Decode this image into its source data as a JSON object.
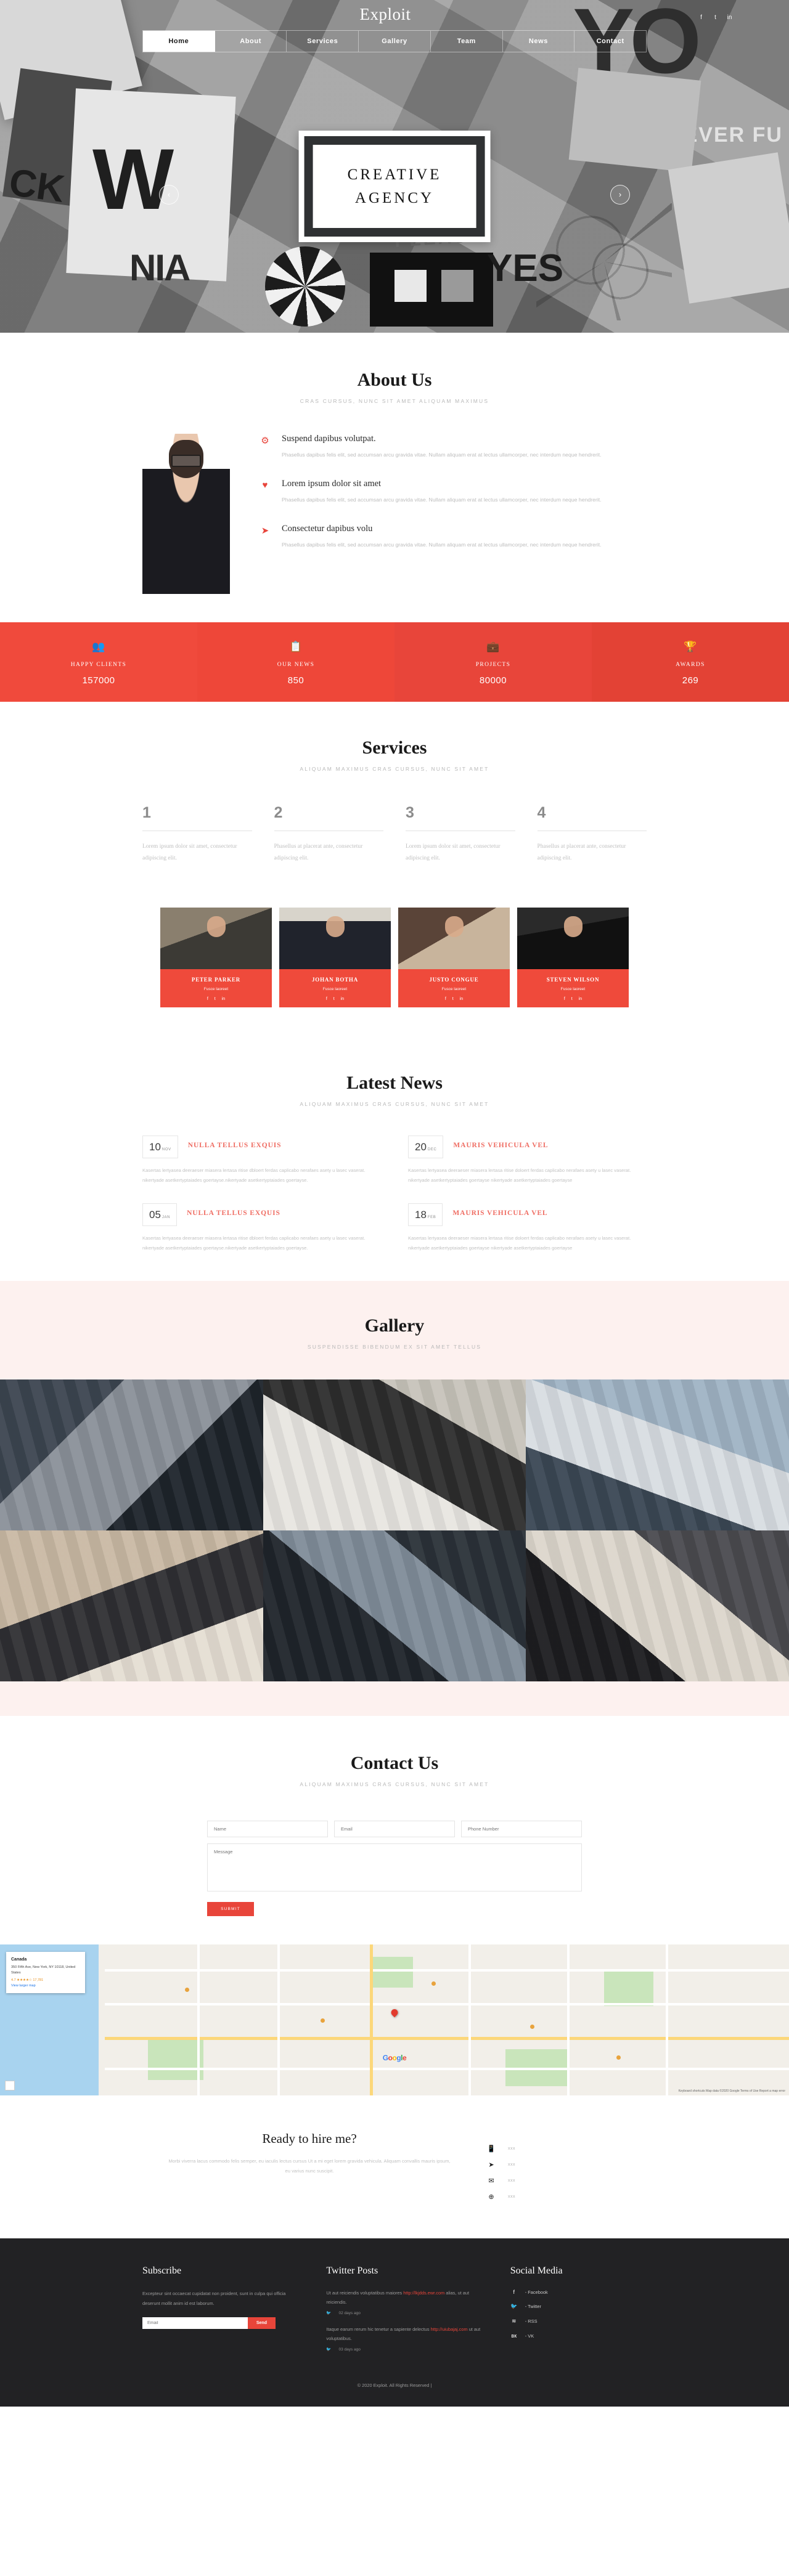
{
  "brand": "Exploit",
  "nav": {
    "items": [
      {
        "label": "Home",
        "active": true
      },
      {
        "label": "About",
        "active": false
      },
      {
        "label": "Services",
        "active": false
      },
      {
        "label": "Gallery",
        "active": false
      },
      {
        "label": "Team",
        "active": false
      },
      {
        "label": "News",
        "active": false
      },
      {
        "label": "Contact",
        "active": false
      }
    ],
    "social": [
      "f",
      "t",
      "in"
    ]
  },
  "hero": {
    "title_line1": "CREATIVE",
    "title_line2": "AGENCY",
    "prev": "‹",
    "next": "›"
  },
  "about": {
    "title": "About Us",
    "subtitle": "CRAS CURSUS, NUNC SIT AMET ALIQUAM MAXIMUS",
    "items": [
      {
        "icon": "gear-icon",
        "glyph": "⚙",
        "heading": "Suspend dapibus volutpat.",
        "text": "Phasellus dapibus felis elit, sed accumsan arcu gravida vitae. Nullam aliquam erat at lectus ullamcorper, nec interdum neque hendrerit."
      },
      {
        "icon": "heart-icon",
        "glyph": "♥",
        "heading": "Lorem ipsum dolor sit amet",
        "text": "Phasellus dapibus felis elit, sed accumsan arcu gravida vitae. Nullam aliquam erat at lectus ullamcorper, nec interdum neque hendrerit."
      },
      {
        "icon": "paper-plane-icon",
        "glyph": "➤",
        "heading": "Consectetur dapibus volu",
        "text": "Phasellus dapibus felis elit, sed accumsan arcu gravida vitae. Nullam aliquam erat at lectus ullamcorper, nec interdum neque hendrerit."
      }
    ]
  },
  "counters": [
    {
      "icon": "users-icon",
      "glyph": "👥",
      "label": "HAPPY CLIENTS",
      "value": "157000"
    },
    {
      "icon": "clipboard-icon",
      "glyph": "📋",
      "label": "OUR NEWS",
      "value": "850"
    },
    {
      "icon": "briefcase-icon",
      "glyph": "💼",
      "label": "PROJECTS",
      "value": "80000"
    },
    {
      "icon": "trophy-icon",
      "glyph": "🏆",
      "label": "AWARDS",
      "value": "269"
    }
  ],
  "services": {
    "title": "Services",
    "subtitle": "ALIQUAM MAXIMUS CRAS CURSUS, NUNC SIT AMET",
    "items": [
      {
        "num": "1",
        "text": "Lorem ipsum dolor sit amet, consectetur adipiscing elit."
      },
      {
        "num": "2",
        "text": "Phasellus at placerat ante, consectetur adipiscing elit."
      },
      {
        "num": "3",
        "text": "Lorem ipsum dolor sit amet, consectetur adipiscing elit."
      },
      {
        "num": "4",
        "text": "Phasellus at placerat ante, consectetur adipiscing elit."
      }
    ]
  },
  "team": {
    "members": [
      {
        "name": "PETER PARKER",
        "role": "Fusce laoreet"
      },
      {
        "name": "JOHAN BOTHA",
        "role": "Fusce laoreet"
      },
      {
        "name": "JUSTO CONGUE",
        "role": "Fusce laoreet"
      },
      {
        "name": "STEVEN WILSON",
        "role": "Fusce laoreet"
      }
    ],
    "social": [
      "f",
      "t",
      "in"
    ]
  },
  "news": {
    "title": "Latest News",
    "subtitle": "ALIQUAM MAXIMUS CRAS CURSUS, NUNC SIT AMET",
    "items": [
      {
        "day": "10",
        "month": "NOV",
        "title": "NULLA TELLUS EXQUIS",
        "text": "Kasertas lertyasea deeraeser miasera lertasa ritise dbloert ferdas caplicabo nerafaes asety u lasec vaserat. nikertyade asetkertyptaiades goertayse.nikertyade asetkertyptaiades goertayse."
      },
      {
        "day": "20",
        "month": "DEC",
        "title": "MAURIS VEHICULA VEL",
        "text": "Kasertas lertyasea deeraeser miasera lertasa ritise doloert ferdas caplicabo nerafaes asety u lasec vaserat. nikertyade asetkertyptaiades goertayse nikertyade asetkertyptaiades goertayse"
      },
      {
        "day": "05",
        "month": "JAN",
        "title": "NULLA TELLUS EXQUIS",
        "text": "Kasertas lertyasea deeraeser miasera lertasa ritise dbloert ferdas caplicabo nerafaes asety u lasec vaserat. nikertyade asetkertyptaiades goertayse.nikertyade asetkertyptaiades goertayse."
      },
      {
        "day": "18",
        "month": "FEB",
        "title": "MAURIS VEHICULA VEL",
        "text": "Kasertas lertyasea deeraeser miasera lertasa ritise doloert ferdas caplicabo nerafaes asety u lasec vaserat. nikertyade asetkertyptaiades goertayse nikertyade asetkertyptaiades goertayse"
      }
    ]
  },
  "gallery": {
    "title": "Gallery",
    "subtitle": "SUSPENDISSE BIBENDUM EX SIT AMET TELLUS"
  },
  "contact": {
    "title": "Contact Us",
    "subtitle": "ALIQUAM MAXIMUS CRAS CURSUS, NUNC SIT AMET",
    "name_placeholder": "Name",
    "email_placeholder": "Email",
    "phone_placeholder": "Phone Number",
    "message_placeholder": "Message",
    "submit_label": "SUBMIT"
  },
  "map": {
    "card_title": "Canada",
    "card_address": "350 Fifth Ave, New York, NY 10118, United States",
    "card_rating": "4.7 ★★★★☆ 17,781",
    "card_link": "View larger map",
    "logo_letters": [
      "G",
      "o",
      "o",
      "g",
      "l",
      "e"
    ],
    "footer": "Keyboard shortcuts    Map data ©2020 Google    Terms of Use    Report a map error"
  },
  "hire": {
    "title": "Ready to hire me?",
    "text": "Morbi viverra lacus commodo felis semper, eu iaculis lectus cursus Ut a mi eget lorem gravida vehicula. Aliquam convallis mauris ipsum, eu varius nunc suscipit.",
    "contacts": [
      {
        "icon": "phone-icon",
        "glyph": "📱",
        "value": "xxx"
      },
      {
        "icon": "paper-plane-icon",
        "glyph": "➤",
        "value": "xxx"
      },
      {
        "icon": "envelope-icon",
        "glyph": "✉",
        "value": "xxx"
      },
      {
        "icon": "globe-icon",
        "glyph": "⊕",
        "value": "xxx"
      }
    ]
  },
  "footer": {
    "subscribe": {
      "heading": "Subscribe",
      "text": "Excepteur sint occaecat cupidatat non proident, sunt in culpa qui officia deserunt mollit anim id est laborum.",
      "email_placeholder": "Email",
      "button_label": "Send"
    },
    "twitter": {
      "heading": "Twitter Posts",
      "posts": [
        {
          "text_before": "Ut aut reiciendis voluptatibus maiores ",
          "link": "http://lkjdds.ewr.com",
          "text_after": " alias, ut aut reiciendis.",
          "meta": "02 days ago",
          "icon_glyph": "🐦"
        },
        {
          "text_before": "Itaque earum rerum hic tenetur a sapiente delectus ",
          "link": "http://uiubajaj.com",
          "text_after": " ut aut voluptatibus.",
          "meta": "03 days ago",
          "icon_glyph": "🐦"
        }
      ]
    },
    "social": {
      "heading": "Social Media",
      "items": [
        {
          "icon": "facebook-icon",
          "glyph": "f",
          "label": "- Facebook"
        },
        {
          "icon": "twitter-icon",
          "glyph": "🐦",
          "label": "- Twitter"
        },
        {
          "icon": "rss-icon",
          "glyph": "≋",
          "label": "- RSS"
        },
        {
          "icon": "vk-icon",
          "glyph": "вк",
          "label": "- VK"
        }
      ]
    },
    "copyright": "© 2020 Exploit. All Rights Reserved |"
  },
  "colors": {
    "accent": "#e8453a",
    "dark": "#222224",
    "gallery_bg": "#fdf1ef"
  }
}
